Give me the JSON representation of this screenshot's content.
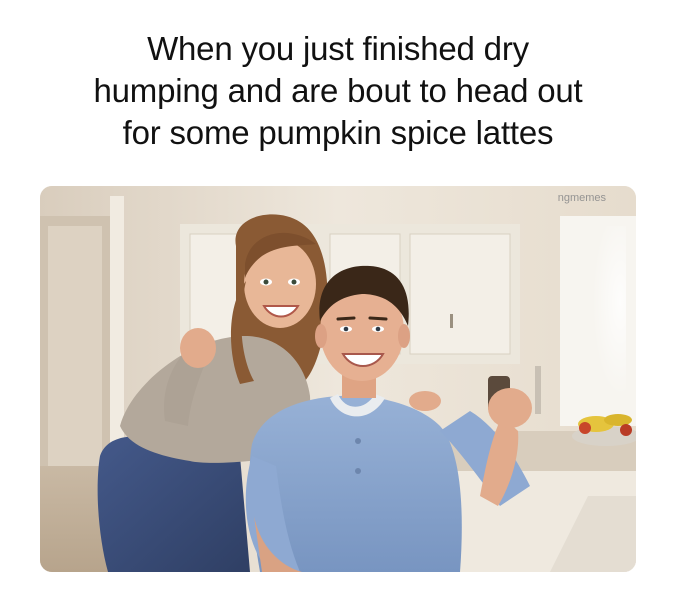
{
  "meme": {
    "caption_lines": [
      "When you just finished dry",
      "humping and are bout to head out",
      "for some pumpkin spice lattes"
    ],
    "watermark": "ngmemes"
  },
  "photo": {
    "subject": "photo-of-couple-in-kitchen",
    "colors": {
      "wall": "#e9e1d4",
      "cabinet": "#ece7dc",
      "woman_top": "#b3a89b",
      "woman_jeans": "#3b4f7a",
      "man_shirt": "#8aa6cf",
      "hair_woman": "#8a5a34",
      "hair_man": "#3a2718",
      "skin": "#e2ab8c"
    }
  }
}
